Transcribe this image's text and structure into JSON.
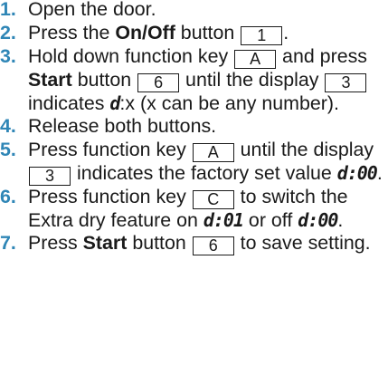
{
  "steps": [
    {
      "num": "1.",
      "text": "Open the door."
    },
    {
      "num": "2.",
      "t1": "Press the ",
      "b1": "On/Off",
      "t2": " button ",
      "k1": "1",
      "t3": "."
    },
    {
      "num": "3.",
      "t1": "Hold down function key ",
      "k1": "A",
      "t2": " and press ",
      "b1": "Start",
      "t3": " button ",
      "k2": "6",
      "t4": " until the display ",
      "k3": "3",
      "t5": " indicates ",
      "d1": "d",
      "t6": ":x (x can be any number)."
    },
    {
      "num": "4.",
      "text": "Release both buttons."
    },
    {
      "num": "5.",
      "t1": "Press function key ",
      "k1": "A",
      "t2": " until the display ",
      "k2": "3",
      "t3": " indicates the factory set value ",
      "d1": "d:00",
      "t4": "."
    },
    {
      "num": "6.",
      "t1": "Press function key ",
      "k1": "C",
      "t2": " to switch the Extra dry feature on ",
      "d1": "d:01",
      "t3": " or off ",
      "d2": "d:00",
      "t4": "."
    },
    {
      "num": "7.",
      "t1": "Press ",
      "b1": "Start",
      "t2": " button ",
      "k1": "6",
      "t3": " to save setting."
    }
  ]
}
